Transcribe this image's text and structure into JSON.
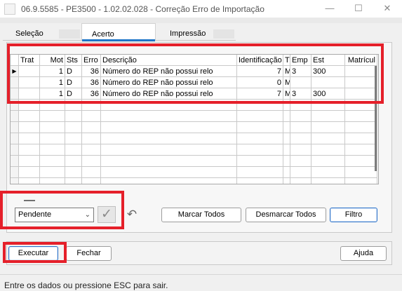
{
  "window": {
    "title": "06.9.5585 - PE3500 - 1.02.02.028 - Correção Erro de Importação",
    "minimize_glyph": "—",
    "maximize_glyph": "☐",
    "close_glyph": "✕"
  },
  "tabs": [
    {
      "label": "Seleção"
    },
    {
      "label": "Acerto"
    },
    {
      "label": "Impressão"
    }
  ],
  "grid": {
    "columns": [
      "Trat",
      "Mot",
      "Sts",
      "Erro",
      "Descrição",
      "Identificação",
      "T",
      "Emp",
      "Est",
      "Matrícul"
    ],
    "rows": [
      [
        "",
        "1",
        "D",
        "36",
        "Número do REP não possui relo",
        "7",
        "M",
        "3",
        "300",
        ""
      ],
      [
        "",
        "1",
        "D",
        "36",
        "Número do REP não possui relo",
        "0",
        "M",
        "",
        "",
        ""
      ],
      [
        "",
        "1",
        "D",
        "36",
        "Número do REP não possui relo",
        "7",
        "M",
        "3",
        "300",
        ""
      ]
    ],
    "current_row_marker": "▶"
  },
  "controls": {
    "status_select_value": "Pendente",
    "confirm_icon": "✓",
    "undo_icon": "↶",
    "chevron_icon": "⌄",
    "mark_all_label": "Marcar Todos",
    "unmark_all_label": "Desmarcar Todos",
    "filter_label": "Filtro"
  },
  "footer_buttons": {
    "execute_label": "Executar",
    "close_label": "Fechar",
    "help_label": "Ajuda"
  },
  "status_bar": {
    "text": "Entre os dados ou pressione ESC para sair."
  },
  "colors": {
    "highlight": "#e5202a",
    "accent": "#2076c9"
  }
}
